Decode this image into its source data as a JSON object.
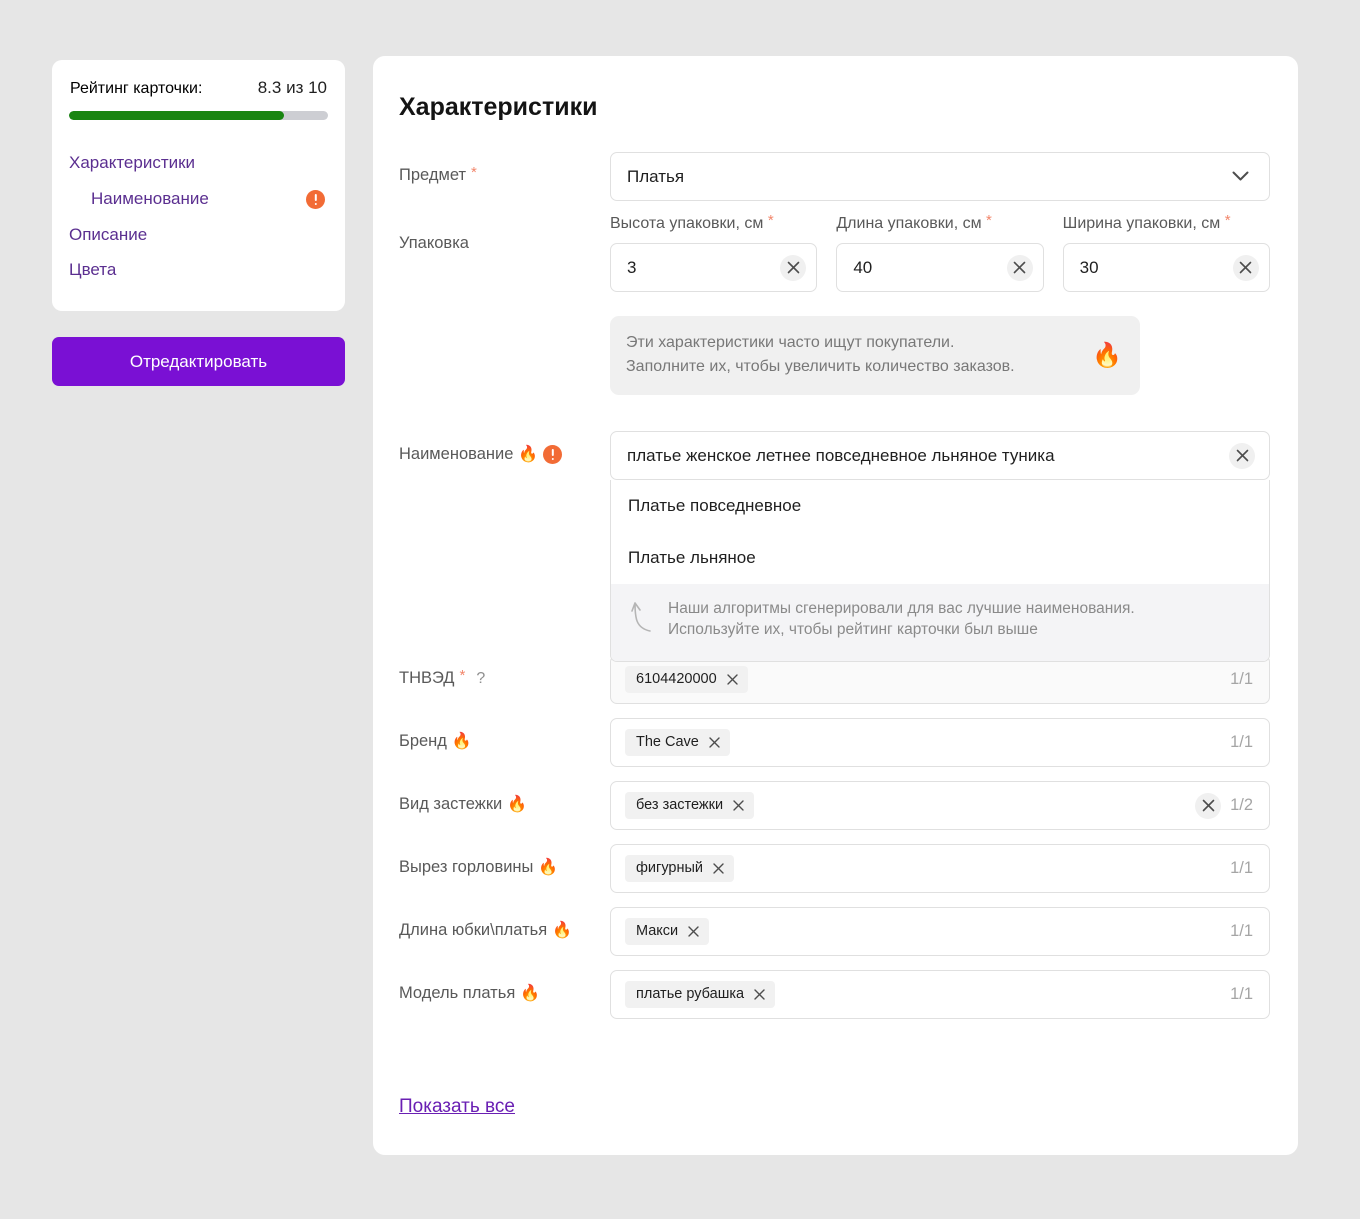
{
  "sidebar": {
    "rating": {
      "label": "Рейтинг карточки:",
      "value": "8.3 из 10",
      "progress_percent": 83
    },
    "nav_items": [
      {
        "label": "Характеристики",
        "sub": false,
        "alert": false
      },
      {
        "label": "Наименование",
        "sub": true,
        "alert": true
      },
      {
        "label": "Описание",
        "sub": false,
        "alert": false
      },
      {
        "label": "Цвета",
        "sub": false,
        "alert": false
      }
    ],
    "edit_button_label": "Отредактировать"
  },
  "main": {
    "title": "Характеристики",
    "subject": {
      "label": "Предмет",
      "required": "*",
      "value": "Платья"
    },
    "packaging": {
      "label": "Упаковка",
      "fields": [
        {
          "caption": "Высота упаковки, см",
          "required": "*",
          "value": "3"
        },
        {
          "caption": "Длина упаковки, см",
          "required": "*",
          "value": "40"
        },
        {
          "caption": "Ширина упаковки, см",
          "required": "*",
          "value": "30"
        }
      ]
    },
    "hint_banner": {
      "line1": "Эти характеристики часто ищут покупатели.",
      "line2": "Заполните их, чтобы увеличить количество заказов.",
      "icon": "fire-emoji"
    },
    "name_field": {
      "label": "Наименование",
      "fire": "🔥",
      "alert_icon": "alert-badge-icon",
      "value": "платье женское летнее повседневное льняное туника",
      "suggestions": [
        "Платье повседневное",
        "Платье льняное"
      ],
      "note_line1": "Наши алгоритмы сгенерировали для вас лучшие наименования.",
      "note_line2": "Используйте их, чтобы рейтинг карточки был выше",
      "note_icon": "hook-arrow-icon"
    },
    "attributes": [
      {
        "label": "ТНВЭД",
        "required": "*",
        "question": "?",
        "fire": false,
        "chips": [
          "6104420000"
        ],
        "counter": "1/1",
        "has_clear": false,
        "grey": true
      },
      {
        "label": "Бренд",
        "required": "",
        "question": "",
        "fire": true,
        "chips": [
          "The Cave"
        ],
        "counter": "1/1",
        "has_clear": false,
        "grey": false
      },
      {
        "label": "Вид застежки",
        "required": "",
        "question": "",
        "fire": true,
        "chips": [
          "без застежки"
        ],
        "counter": "1/2",
        "has_clear": true,
        "grey": false
      },
      {
        "label": "Вырез горловины",
        "required": "",
        "question": "",
        "fire": true,
        "chips": [
          "фигурный"
        ],
        "counter": "1/1",
        "has_clear": false,
        "grey": false
      },
      {
        "label": "Длина юбки\\платья",
        "required": "",
        "question": "",
        "fire": true,
        "chips": [
          "Макси"
        ],
        "counter": "1/1",
        "has_clear": false,
        "grey": false
      },
      {
        "label": "Модель платья",
        "required": "",
        "question": "",
        "fire": true,
        "chips": [
          "платье рубашка"
        ],
        "counter": "1/1",
        "has_clear": false,
        "grey": false
      }
    ],
    "show_all_label": "Показать все"
  },
  "colors": {
    "accent_purple": "#7a10d4",
    "link_purple": "#5b2f90",
    "progress_green": "#198511",
    "alert_orange": "#f26b35",
    "page_bg": "#e6e6e6"
  }
}
